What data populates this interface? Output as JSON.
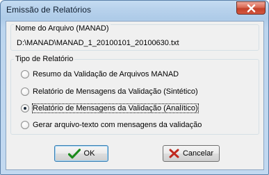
{
  "window": {
    "title": "Emissão de Relatórios",
    "close_icon": "close-icon"
  },
  "file_group": {
    "legend": "Nome do Arquivo (MANAD)",
    "path": "D:\\MANAD\\MANAD_1_20100101_20100630.txt"
  },
  "report_group": {
    "legend": "Tipo de Relatório",
    "options": [
      {
        "label": "Resumo da Validação de Arquivos MANAD",
        "selected": false
      },
      {
        "label": "Relatório de Mensagens da Validação (Sintético)",
        "selected": false
      },
      {
        "label": "Relatório de Mensagens da Validação (Analítico)",
        "selected": true
      },
      {
        "label": "Gerar arquivo-texto com mensagens da validação",
        "selected": false
      }
    ]
  },
  "buttons": {
    "ok": {
      "label": "OK",
      "icon": "checkmark-icon"
    },
    "cancel": {
      "label": "Cancelar",
      "icon": "x-cancel-icon"
    }
  },
  "colors": {
    "ok_check": "#1c8a1c",
    "cancel_x": "#c0281e",
    "close_button": "#c3412a"
  }
}
